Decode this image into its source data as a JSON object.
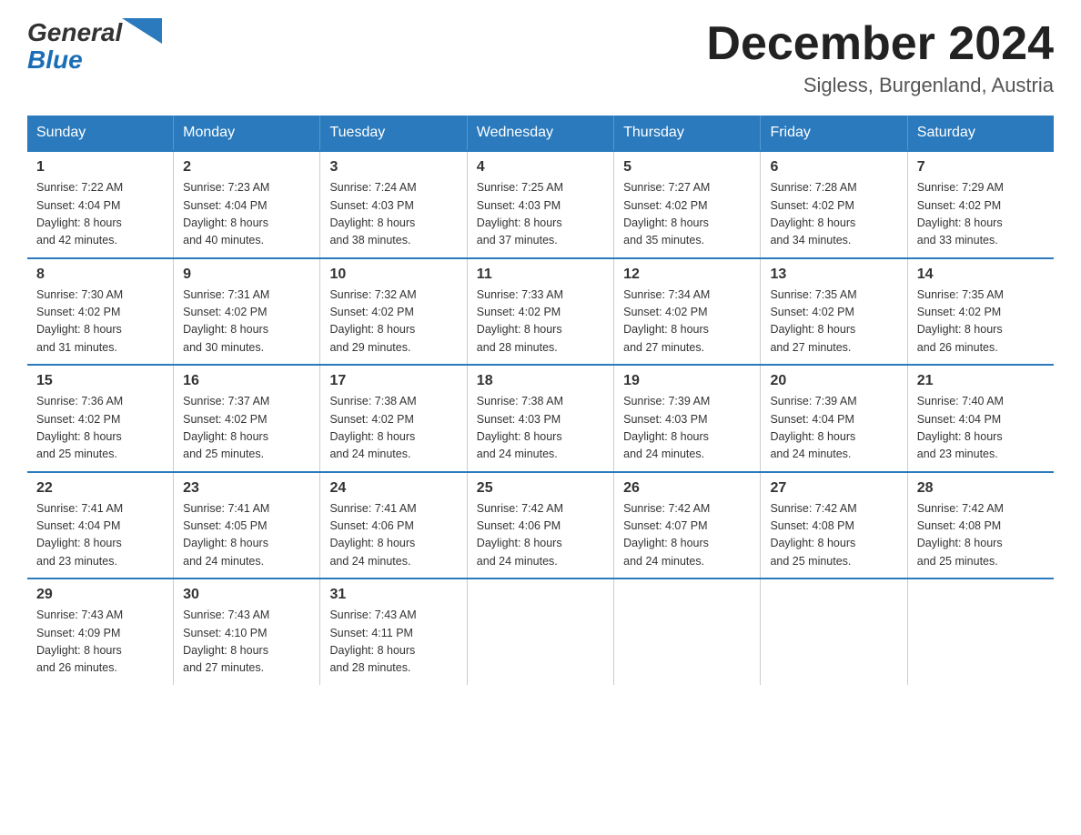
{
  "logo": {
    "general": "General",
    "blue": "Blue",
    "alt": "GeneralBlue logo"
  },
  "header": {
    "month_year": "December 2024",
    "location": "Sigless, Burgenland, Austria"
  },
  "weekdays": [
    "Sunday",
    "Monday",
    "Tuesday",
    "Wednesday",
    "Thursday",
    "Friday",
    "Saturday"
  ],
  "weeks": [
    [
      {
        "day": "1",
        "sunrise": "7:22 AM",
        "sunset": "4:04 PM",
        "daylight": "8 hours and 42 minutes."
      },
      {
        "day": "2",
        "sunrise": "7:23 AM",
        "sunset": "4:04 PM",
        "daylight": "8 hours and 40 minutes."
      },
      {
        "day": "3",
        "sunrise": "7:24 AM",
        "sunset": "4:03 PM",
        "daylight": "8 hours and 38 minutes."
      },
      {
        "day": "4",
        "sunrise": "7:25 AM",
        "sunset": "4:03 PM",
        "daylight": "8 hours and 37 minutes."
      },
      {
        "day": "5",
        "sunrise": "7:27 AM",
        "sunset": "4:02 PM",
        "daylight": "8 hours and 35 minutes."
      },
      {
        "day": "6",
        "sunrise": "7:28 AM",
        "sunset": "4:02 PM",
        "daylight": "8 hours and 34 minutes."
      },
      {
        "day": "7",
        "sunrise": "7:29 AM",
        "sunset": "4:02 PM",
        "daylight": "8 hours and 33 minutes."
      }
    ],
    [
      {
        "day": "8",
        "sunrise": "7:30 AM",
        "sunset": "4:02 PM",
        "daylight": "8 hours and 31 minutes."
      },
      {
        "day": "9",
        "sunrise": "7:31 AM",
        "sunset": "4:02 PM",
        "daylight": "8 hours and 30 minutes."
      },
      {
        "day": "10",
        "sunrise": "7:32 AM",
        "sunset": "4:02 PM",
        "daylight": "8 hours and 29 minutes."
      },
      {
        "day": "11",
        "sunrise": "7:33 AM",
        "sunset": "4:02 PM",
        "daylight": "8 hours and 28 minutes."
      },
      {
        "day": "12",
        "sunrise": "7:34 AM",
        "sunset": "4:02 PM",
        "daylight": "8 hours and 27 minutes."
      },
      {
        "day": "13",
        "sunrise": "7:35 AM",
        "sunset": "4:02 PM",
        "daylight": "8 hours and 27 minutes."
      },
      {
        "day": "14",
        "sunrise": "7:35 AM",
        "sunset": "4:02 PM",
        "daylight": "8 hours and 26 minutes."
      }
    ],
    [
      {
        "day": "15",
        "sunrise": "7:36 AM",
        "sunset": "4:02 PM",
        "daylight": "8 hours and 25 minutes."
      },
      {
        "day": "16",
        "sunrise": "7:37 AM",
        "sunset": "4:02 PM",
        "daylight": "8 hours and 25 minutes."
      },
      {
        "day": "17",
        "sunrise": "7:38 AM",
        "sunset": "4:02 PM",
        "daylight": "8 hours and 24 minutes."
      },
      {
        "day": "18",
        "sunrise": "7:38 AM",
        "sunset": "4:03 PM",
        "daylight": "8 hours and 24 minutes."
      },
      {
        "day": "19",
        "sunrise": "7:39 AM",
        "sunset": "4:03 PM",
        "daylight": "8 hours and 24 minutes."
      },
      {
        "day": "20",
        "sunrise": "7:39 AM",
        "sunset": "4:04 PM",
        "daylight": "8 hours and 24 minutes."
      },
      {
        "day": "21",
        "sunrise": "7:40 AM",
        "sunset": "4:04 PM",
        "daylight": "8 hours and 23 minutes."
      }
    ],
    [
      {
        "day": "22",
        "sunrise": "7:41 AM",
        "sunset": "4:04 PM",
        "daylight": "8 hours and 23 minutes."
      },
      {
        "day": "23",
        "sunrise": "7:41 AM",
        "sunset": "4:05 PM",
        "daylight": "8 hours and 24 minutes."
      },
      {
        "day": "24",
        "sunrise": "7:41 AM",
        "sunset": "4:06 PM",
        "daylight": "8 hours and 24 minutes."
      },
      {
        "day": "25",
        "sunrise": "7:42 AM",
        "sunset": "4:06 PM",
        "daylight": "8 hours and 24 minutes."
      },
      {
        "day": "26",
        "sunrise": "7:42 AM",
        "sunset": "4:07 PM",
        "daylight": "8 hours and 24 minutes."
      },
      {
        "day": "27",
        "sunrise": "7:42 AM",
        "sunset": "4:08 PM",
        "daylight": "8 hours and 25 minutes."
      },
      {
        "day": "28",
        "sunrise": "7:42 AM",
        "sunset": "4:08 PM",
        "daylight": "8 hours and 25 minutes."
      }
    ],
    [
      {
        "day": "29",
        "sunrise": "7:43 AM",
        "sunset": "4:09 PM",
        "daylight": "8 hours and 26 minutes."
      },
      {
        "day": "30",
        "sunrise": "7:43 AM",
        "sunset": "4:10 PM",
        "daylight": "8 hours and 27 minutes."
      },
      {
        "day": "31",
        "sunrise": "7:43 AM",
        "sunset": "4:11 PM",
        "daylight": "8 hours and 28 minutes."
      },
      null,
      null,
      null,
      null
    ]
  ],
  "labels": {
    "sunrise": "Sunrise:",
    "sunset": "Sunset:",
    "daylight": "Daylight:"
  }
}
